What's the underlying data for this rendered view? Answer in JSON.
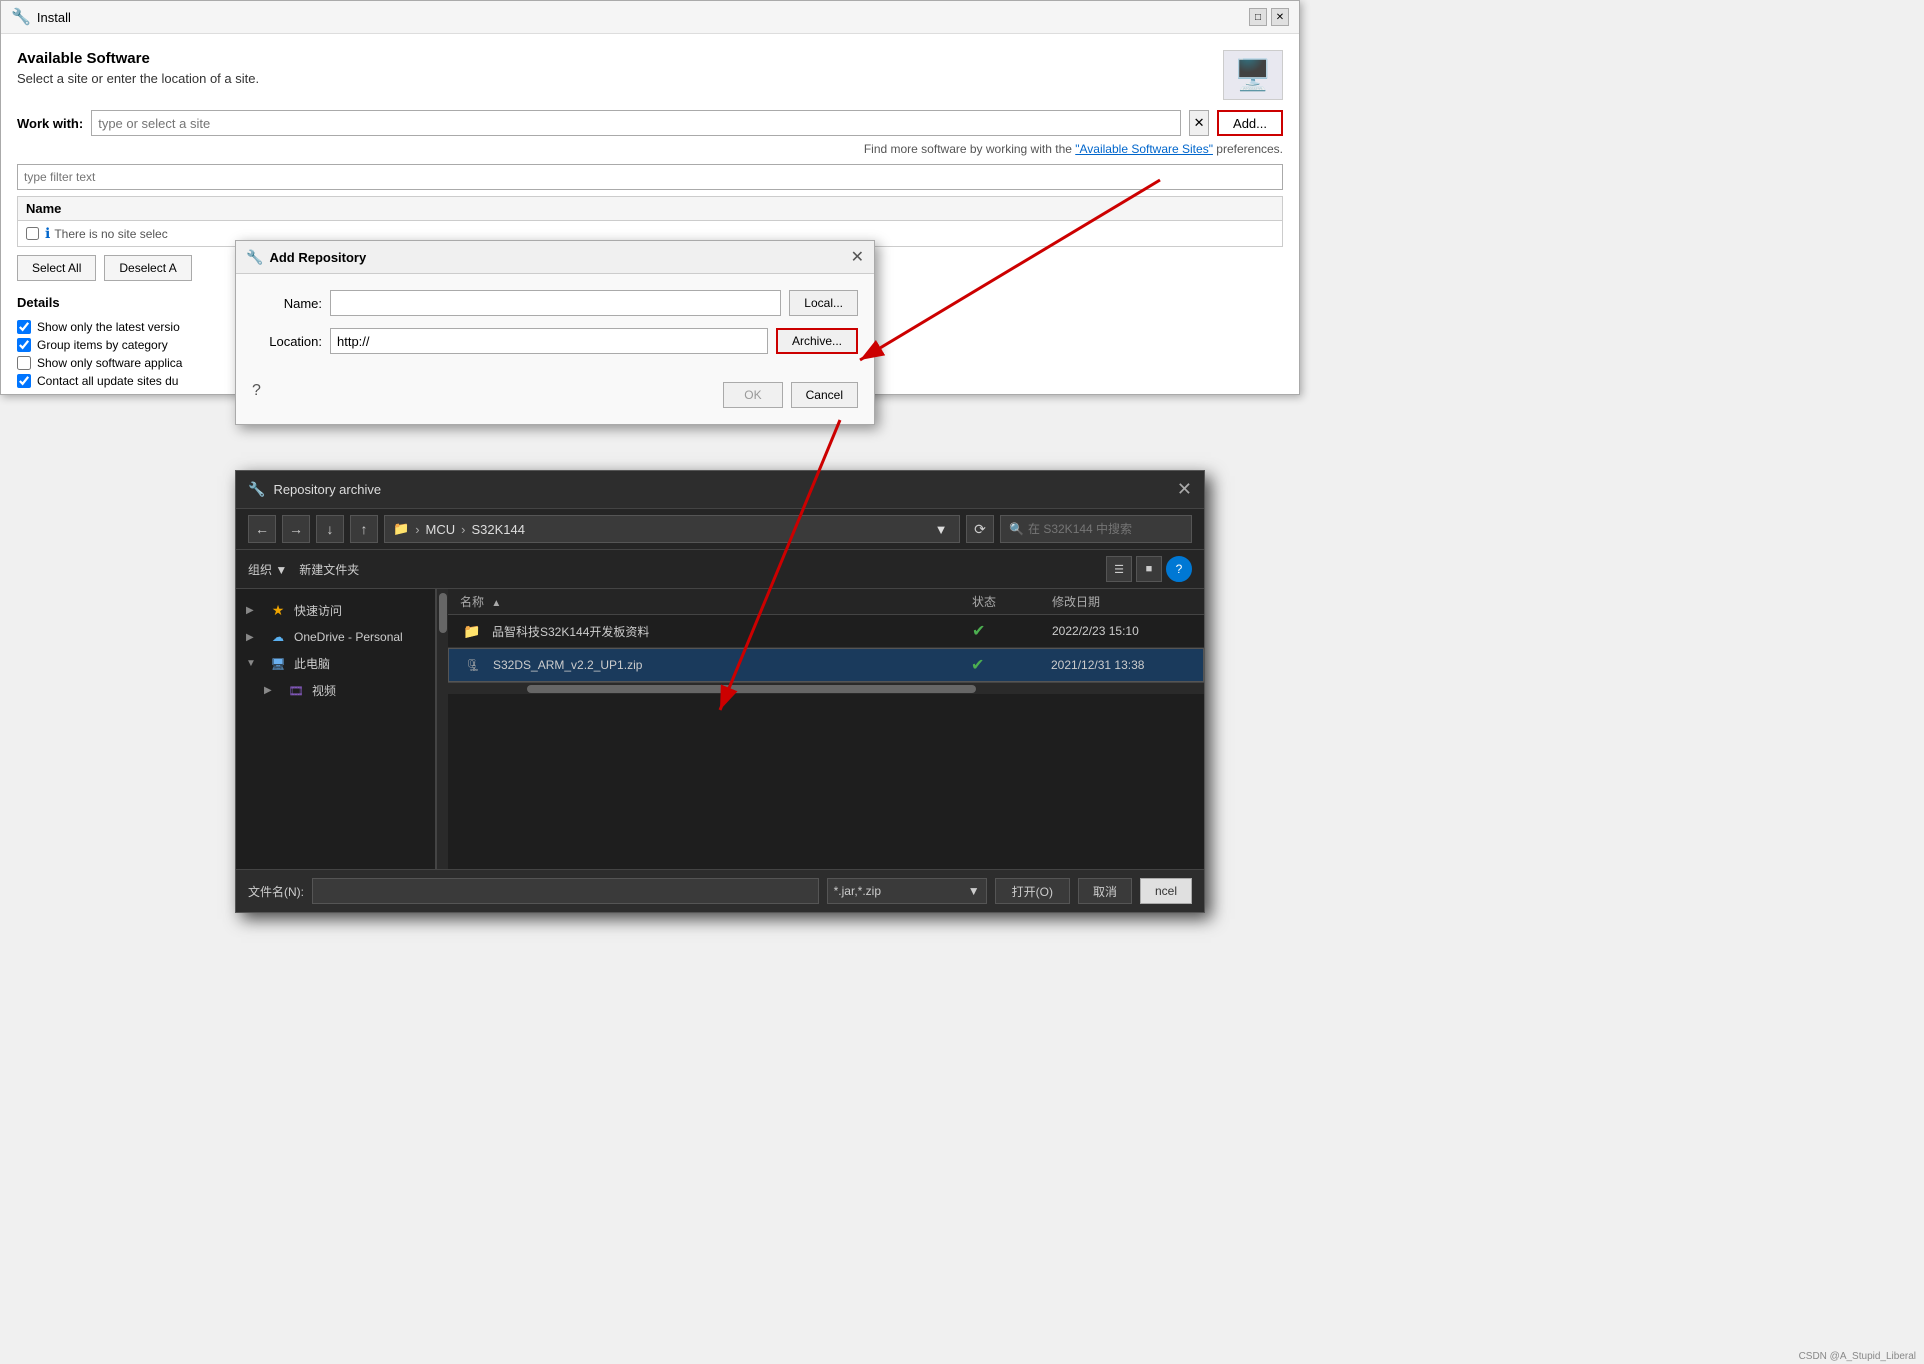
{
  "install_window": {
    "title": "Install",
    "header": {
      "title": "Available Software",
      "subtitle": "Select a site or enter the location of a site."
    },
    "work_with_label": "Work with:",
    "work_with_placeholder": "type or select a site",
    "add_button": "Add...",
    "find_more_text": "Find more software by working with the ",
    "find_more_link": "\"Available Software Sites\"",
    "find_more_suffix": " preferences.",
    "filter_placeholder": "type filter text",
    "table_header_name": "Name",
    "no_site_msg": "There is no site selec",
    "select_all": "Select All",
    "deselect_all": "Deselect A",
    "details_label": "Details",
    "options": [
      {
        "id": "opt1",
        "label": "Show only the latest versio",
        "checked": true
      },
      {
        "id": "opt2",
        "label": "Group items by category",
        "checked": true
      },
      {
        "id": "opt3",
        "label": "Show only software applica",
        "checked": false
      },
      {
        "id": "opt4",
        "label": "Contact all update sites du",
        "checked": true
      }
    ]
  },
  "add_repo_dialog": {
    "title": "Add Repository",
    "name_label": "Name:",
    "name_value": "",
    "location_label": "Location:",
    "location_value": "http://",
    "local_btn": "Local...",
    "archive_btn": "Archive...",
    "ok_btn": "OK",
    "cancel_btn": "Cancel"
  },
  "repo_archive_dialog": {
    "title": "Repository archive",
    "path": "MCU > S32K144",
    "path_parts": [
      "MCU",
      "S32K144"
    ],
    "search_placeholder": "在 S32K144 中搜索",
    "organize_btn": "组织 ▼",
    "new_folder_btn": "新建文件夹",
    "sidebar_items": [
      {
        "name": "快速访问",
        "icon": "star",
        "expand": "▶",
        "indent": 0
      },
      {
        "name": "OneDrive - Personal",
        "icon": "cloud",
        "expand": "▶",
        "indent": 0
      },
      {
        "name": "此电脑",
        "icon": "pc",
        "expand": "▼",
        "indent": 0
      },
      {
        "name": "视频",
        "icon": "video",
        "expand": "▶",
        "indent": 1
      }
    ],
    "col_name": "名称",
    "col_status": "状态",
    "col_date": "修改日期",
    "files": [
      {
        "name": "品智科技S32K144开发板资料",
        "type": "folder",
        "status": "✔",
        "status_color": "#4caf50",
        "date": "2022/2/23 15:10",
        "selected": false
      },
      {
        "name": "S32DS_ARM_v2.2_UP1.zip",
        "type": "zip",
        "status": "✔",
        "status_color": "#4caf50",
        "date": "2021/12/31 13:38",
        "selected": true
      }
    ],
    "filename_label": "文件名(N):",
    "filename_value": "",
    "filetype_value": "*.jar,*.zip",
    "open_btn": "打开(O)",
    "cancel_btn": "取消"
  },
  "watermark": "CSDN @A_Stupid_Liberal"
}
